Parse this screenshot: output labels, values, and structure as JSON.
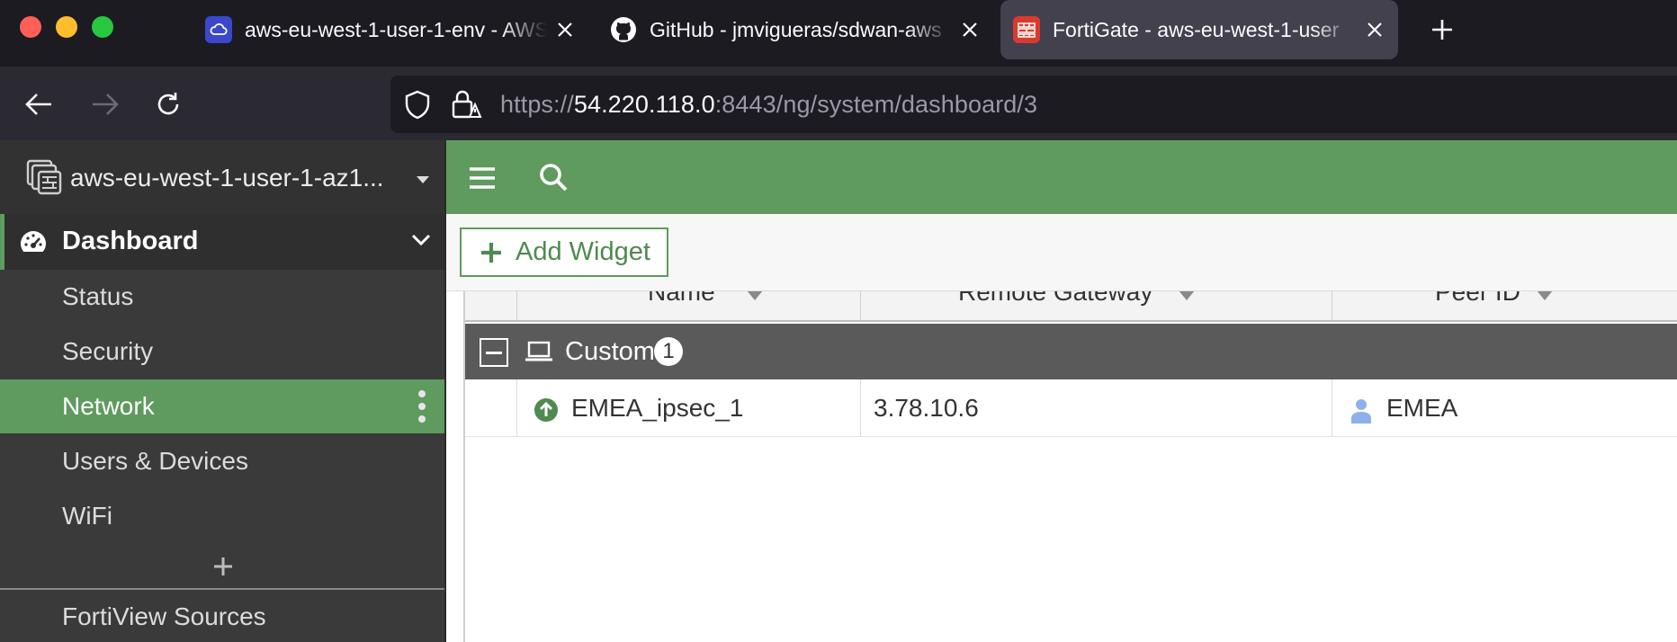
{
  "browser": {
    "tabs": [
      {
        "title": "aws-eu-west-1-user-1-env - AWS",
        "favicon": "cloud-icon",
        "active": false
      },
      {
        "title": "GitHub - jmvigueras/sdwan-aws",
        "favicon": "github-icon",
        "active": false
      },
      {
        "title": "FortiGate - aws-eu-west-1-user",
        "favicon": "fortigate-icon",
        "active": true
      }
    ],
    "url_prefix": "https://",
    "url_host": "54.220.118.0",
    "url_rest": ":8443/ng/system/dashboard/3"
  },
  "sidebar": {
    "device_name": "aws-eu-west-1-user-1-az1...",
    "dashboard_label": "Dashboard",
    "items": [
      {
        "label": "Status",
        "active": false
      },
      {
        "label": "Security",
        "active": false
      },
      {
        "label": "Network",
        "active": true
      },
      {
        "label": "Users & Devices",
        "active": false
      },
      {
        "label": "WiFi",
        "active": false
      }
    ],
    "fortiview_label": "FortiView Sources"
  },
  "toolbar": {
    "add_widget_label": "Add Widget"
  },
  "table": {
    "columns": [
      "Name",
      "Remote Gateway",
      "Peer ID"
    ],
    "group": {
      "label": "Custom",
      "count": "1"
    },
    "rows": [
      {
        "name": "EMEA_ipsec_1",
        "remote_gateway": "3.78.10.6",
        "peer_id": "EMEA",
        "status": "up"
      }
    ]
  },
  "colors": {
    "fortinet_green": "#5f9a5f",
    "sidebar_bg": "#3a3a3a",
    "browser_bg": "#1c1b22"
  }
}
